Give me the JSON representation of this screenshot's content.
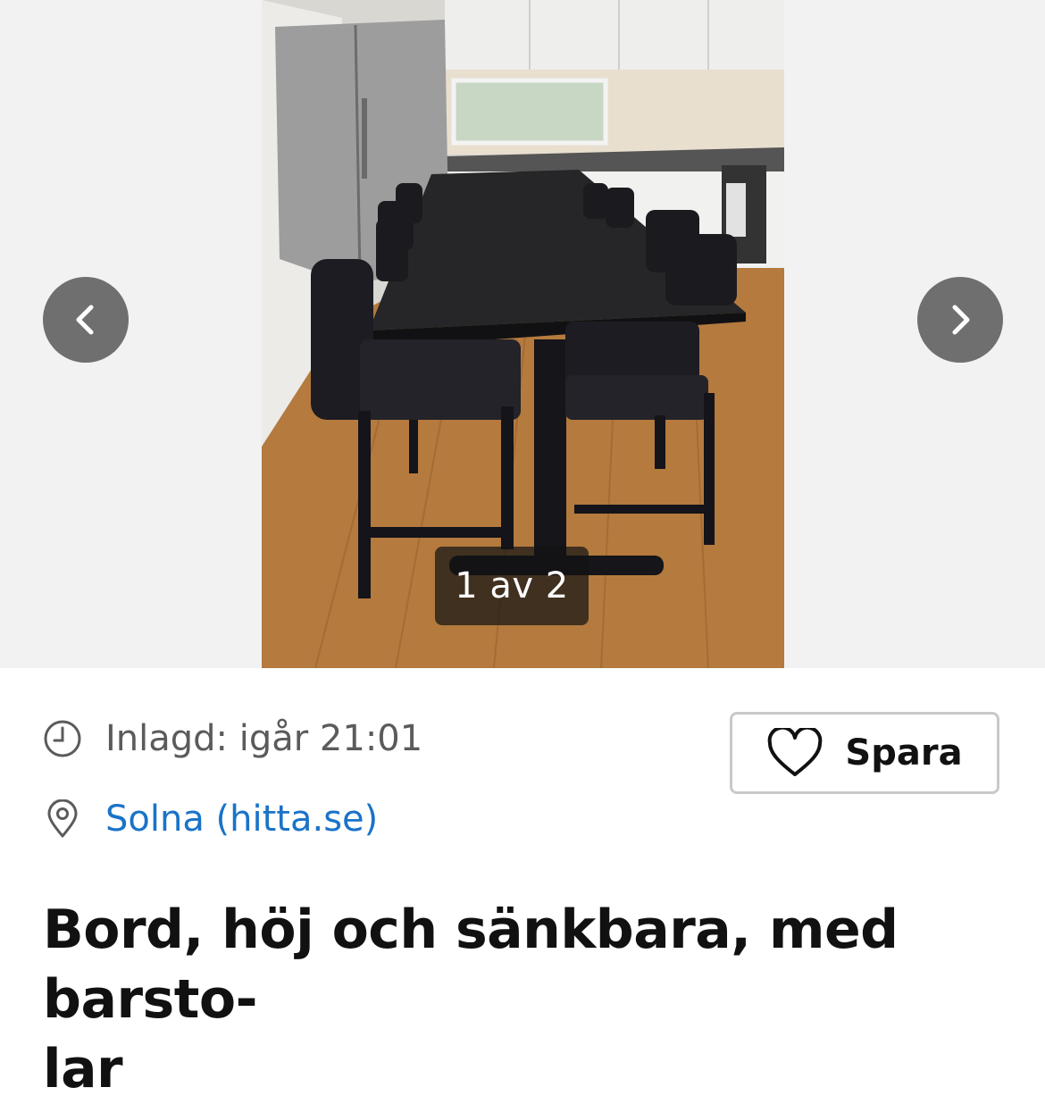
{
  "gallery": {
    "counter": "1 av 2",
    "prev_icon": "chevron-left-icon",
    "next_icon": "chevron-right-icon",
    "photo_alt": "Bord med barstolar i kök"
  },
  "listing": {
    "posted_label": "Inlagd: igår 21:01",
    "location_label": "Solna (hitta.se)",
    "save_label": "Spara",
    "title": "Bord, höj och sänkbara, med barsto-\nlar"
  },
  "colors": {
    "link": "#1a73c8",
    "nav_button": "#6f6f6f",
    "muted_text": "#5b5b5b"
  }
}
